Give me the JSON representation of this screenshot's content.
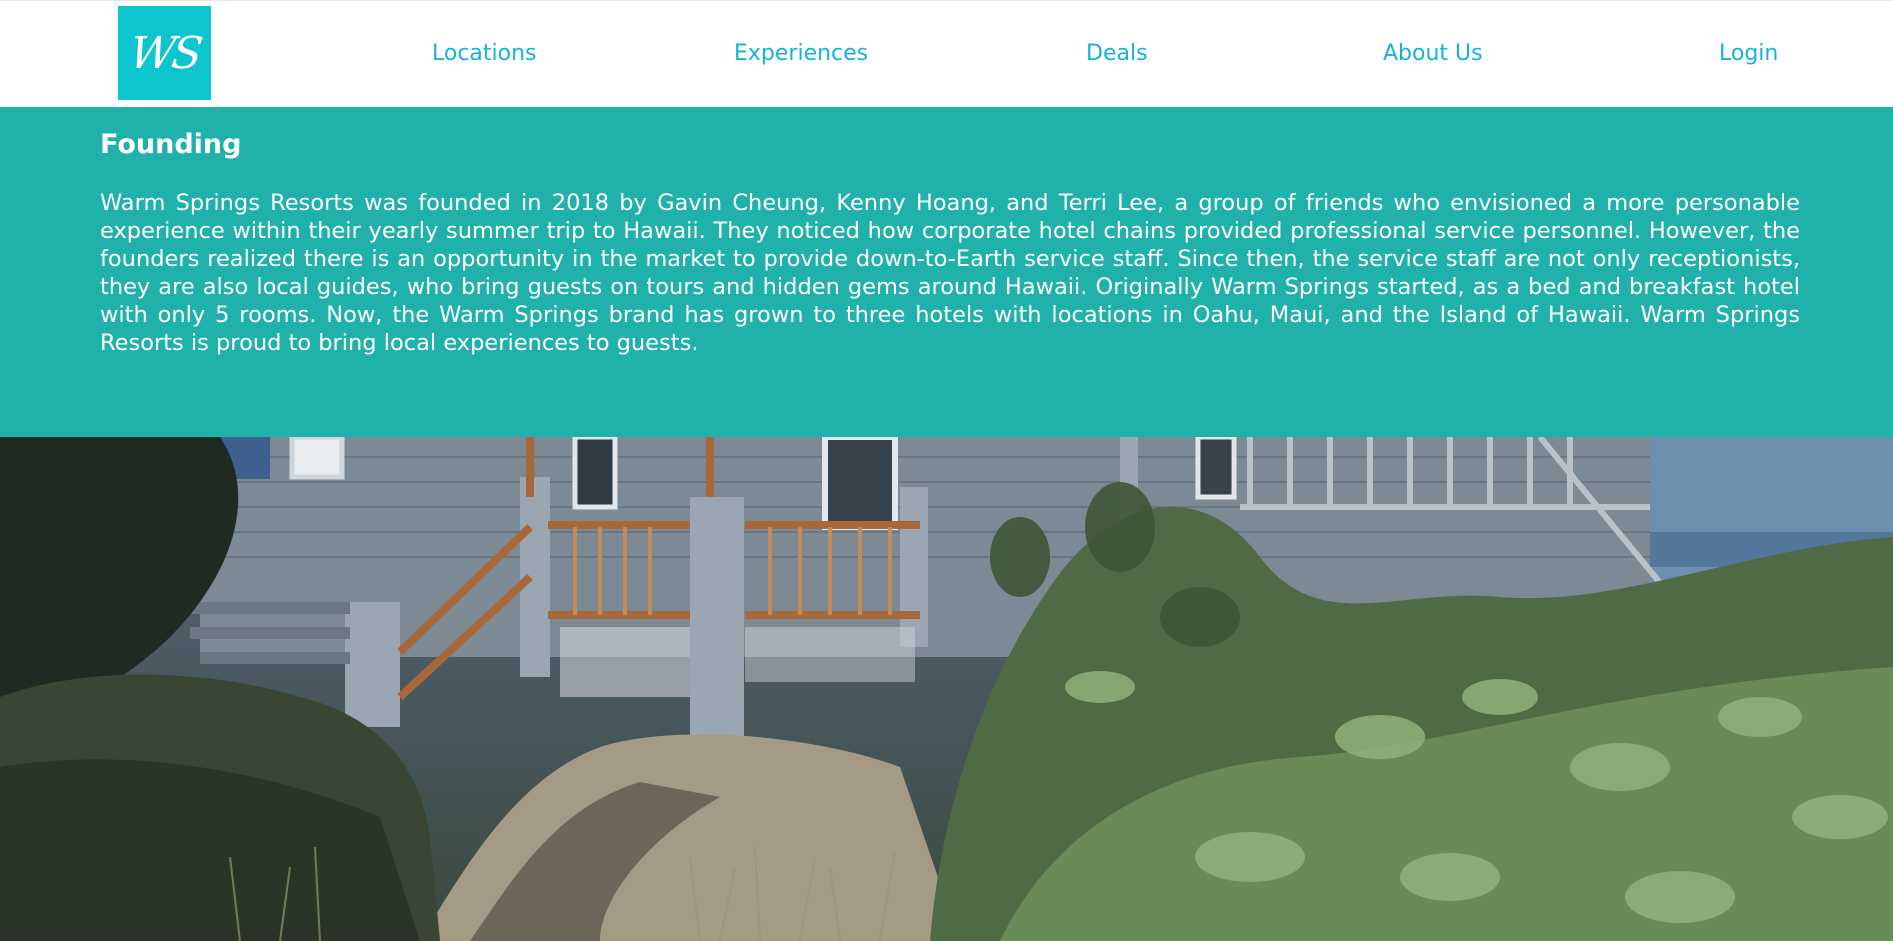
{
  "header": {
    "logo_text": "WS",
    "nav": {
      "locations": "Locations",
      "experiences": "Experiences",
      "deals": "Deals",
      "about": "About Us",
      "login": "Login"
    }
  },
  "founding": {
    "title": "Founding",
    "body": "Warm Springs Resorts was founded in 2018 by Gavin Cheung, Kenny Hoang, and Terri Lee, a group of friends who envisioned a more personable experience within their yearly summer trip to Hawaii. They noticed how corporate hotel chains provided professional service personnel. However, the founders realized there is an opportunity in the market to provide down-to-Earth service staff. Since then, the service staff are not only receptionists, they are also local guides, who bring guests on tours and hidden gems around Hawaii. Originally Warm Springs started, as a bed and breakfast hotel with only 5 rooms. Now, the Warm Springs brand has grown to three hotels with locations in Oahu, Maui, and the Island of Hawaii. Warm Springs Resorts is proud to bring local experiences to guests."
  },
  "colors": {
    "brand_teal": "#21b1ab",
    "logo_cyan": "#0dc5cf",
    "nav_link": "#17b3d6"
  }
}
